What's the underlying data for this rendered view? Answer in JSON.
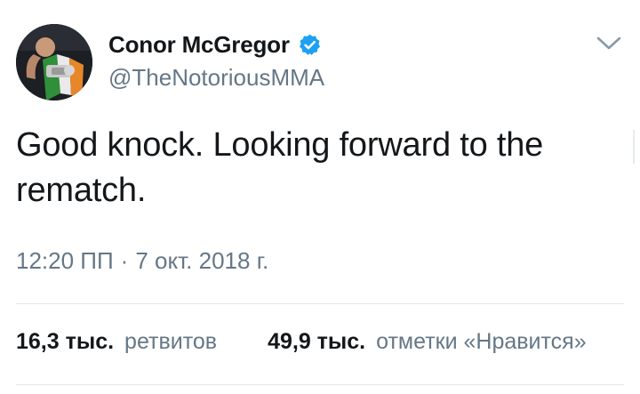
{
  "author": {
    "display_name": "Conor McGregor",
    "handle": "@TheNotoriousMMA",
    "verified": true,
    "verified_color": "#1da1f2",
    "avatar_icon": "profile-photo"
  },
  "menu_icon": "chevron-down-icon",
  "tweet": {
    "text": "Good knock. Looking forward to the rematch."
  },
  "meta": {
    "time": "12:20 ПП",
    "separator": "·",
    "date": "7 окт. 2018 г."
  },
  "stats": {
    "retweets_count": "16,3 тыс.",
    "retweets_label": "ретвитов",
    "likes_count": "49,9 тыс.",
    "likes_label": "отметки «Нравится»"
  },
  "colors": {
    "primary_text": "#14171a",
    "secondary_text": "#657786",
    "divider": "#e1e8ed"
  }
}
